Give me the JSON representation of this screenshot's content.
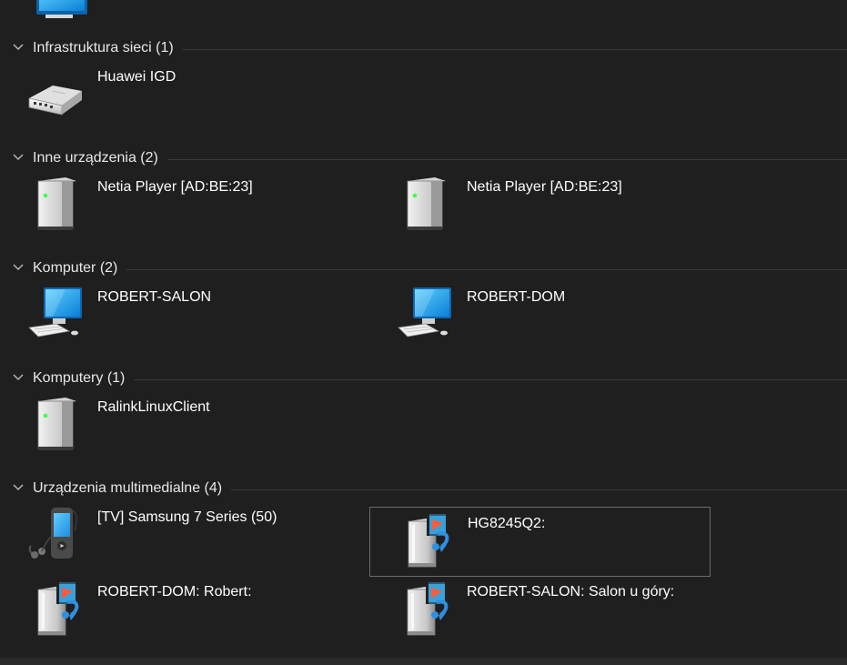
{
  "groups": [
    {
      "title": "Infrastruktura sieci (1)",
      "items": [
        {
          "label": "Huawei IGD",
          "icon": "router-icon"
        }
      ]
    },
    {
      "title": "Inne urządzenia (2)",
      "items": [
        {
          "label": "Netia Player [AD:BE:23]",
          "icon": "device-tower-icon"
        },
        {
          "label": "Netia Player [AD:BE:23]",
          "icon": "device-tower-icon"
        }
      ]
    },
    {
      "title": "Komputer (2)",
      "items": [
        {
          "label": "ROBERT-SALON",
          "icon": "computer-icon"
        },
        {
          "label": "ROBERT-DOM",
          "icon": "computer-icon"
        }
      ]
    },
    {
      "title": "Komputery (1)",
      "items": [
        {
          "label": "RalinkLinuxClient",
          "icon": "device-tower-icon"
        }
      ]
    },
    {
      "title": "Urządzenia multimedialne (4)",
      "items": [
        {
          "label": "[TV] Samsung 7 Series (50)",
          "icon": "media-player-phone-icon"
        },
        {
          "label": "HG8245Q2:",
          "icon": "media-server-icon",
          "selected": true
        },
        {
          "label": "ROBERT-DOM: Robert:",
          "icon": "media-server-icon"
        },
        {
          "label": "ROBERT-SALON: Salon u góry:",
          "icon": "media-server-icon"
        }
      ]
    }
  ],
  "colors": {
    "background": "#1f1f1f",
    "separator": "#3a3a3a",
    "selection_border": "#6b6b6b",
    "text": "#ffffff"
  }
}
